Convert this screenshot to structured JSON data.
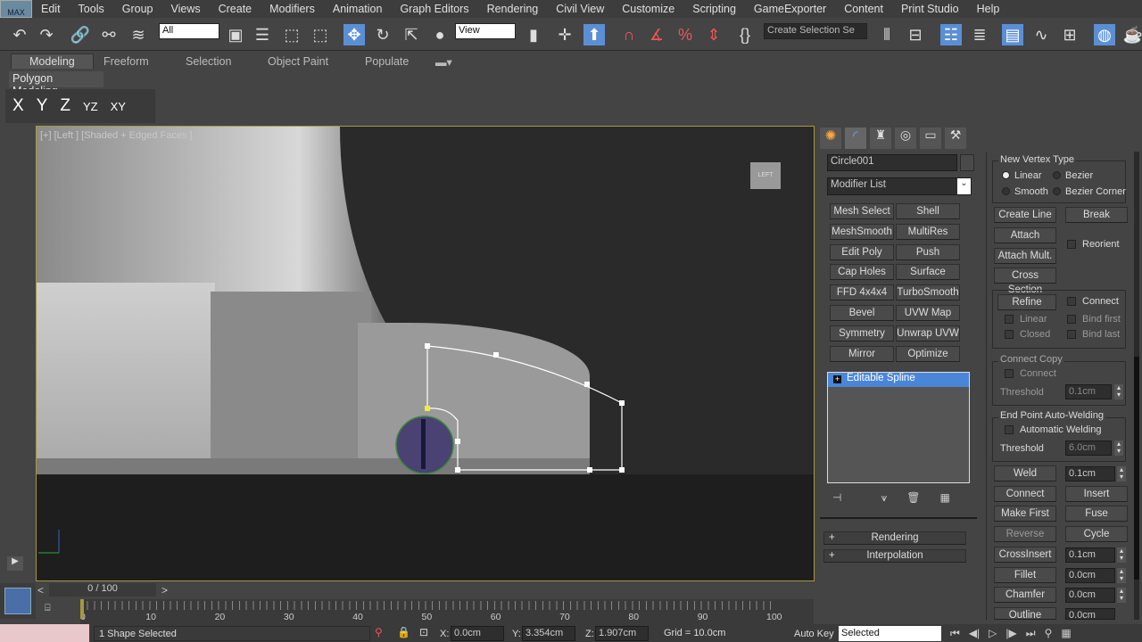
{
  "app": {
    "logo": "MAX"
  },
  "menu": [
    "Edit",
    "Tools",
    "Group",
    "Views",
    "Create",
    "Modifiers",
    "Animation",
    "Graph Editors",
    "Rendering",
    "Civil View",
    "Customize",
    "Scripting",
    "GameExporter",
    "Content",
    "Print Studio",
    "Help"
  ],
  "toolbar": {
    "selection_filter": "All",
    "ref_coord": "View",
    "named_selection": "Create Selection Se"
  },
  "ribbon": {
    "tabs": [
      "Modeling",
      "Freeform",
      "Selection",
      "Object Paint",
      "Populate"
    ],
    "panel": "Polygon Modeling"
  },
  "axis_constraints": [
    "X",
    "Y",
    "Z",
    "YZ",
    "XY"
  ],
  "viewport": {
    "label": "[+] [Left ] [Shaded + Edged Faces ]",
    "viewcube": "LEFT"
  },
  "command_panel": {
    "object_name": "Circle001",
    "modifier_list": "Modifier List",
    "modifier_buttons": [
      "Mesh Select",
      "Shell",
      "MeshSmooth",
      "MultiRes",
      "Edit Poly",
      "Push",
      "Cap Holes",
      "Surface",
      "FFD 4x4x4",
      "TurboSmooth",
      "Bevel",
      "UVW Map",
      "Symmetry",
      "Unwrap UVW",
      "Mirror",
      "Optimize"
    ],
    "stack": [
      "Editable Spline"
    ],
    "rollouts": [
      "Rendering",
      "Interpolation"
    ]
  },
  "geometry": {
    "new_vertex_type": {
      "title": "New Vertex Type",
      "options": [
        "Linear",
        "Bezier",
        "Smooth",
        "Bezier Corner"
      ],
      "selected": "Linear"
    },
    "create_line": "Create Line",
    "break": "Break",
    "attach": "Attach",
    "reorient": "Reorient",
    "attach_mult": "Attach Mult.",
    "cross_section": "Cross Section",
    "refine": "Refine",
    "connect": "Connect",
    "linear": "Linear",
    "bind_first": "Bind first",
    "closed": "Closed",
    "bind_last": "Bind last",
    "connect_copy": {
      "title": "Connect Copy",
      "connect": "Connect",
      "threshold_label": "Threshold",
      "threshold": "0.1cm"
    },
    "auto_weld": {
      "title": "End Point Auto-Welding",
      "auto": "Automatic Welding",
      "threshold_label": "Threshold",
      "threshold": "6.0cm"
    },
    "weld": "Weld",
    "weld_value": "0.1cm",
    "connect2": "Connect",
    "insert": "Insert",
    "make_first": "Make First",
    "fuse": "Fuse",
    "reverse": "Reverse",
    "cycle": "Cycle",
    "crossinsert": "CrossInsert",
    "crossinsert_value": "0.1cm",
    "fillet": "Fillet",
    "fillet_value": "0.0cm",
    "chamfer": "Chamfer",
    "chamfer_value": "0.0cm",
    "outline": "Outline",
    "outline_value": "0.0cm"
  },
  "timeline": {
    "frame": "0 / 100",
    "ticks": [
      "0",
      "10",
      "20",
      "30",
      "40",
      "50",
      "60",
      "70",
      "80",
      "90",
      "100"
    ]
  },
  "status": {
    "selection": "1 Shape Selected",
    "x_label": "X:",
    "x": "0.0cm",
    "y_label": "Y:",
    "y": "3.354cm",
    "z_label": "Z:",
    "z": "1.907cm",
    "grid": "Grid = 10.0cm",
    "auto_key": "Auto Key",
    "key_filter": "Selected"
  }
}
